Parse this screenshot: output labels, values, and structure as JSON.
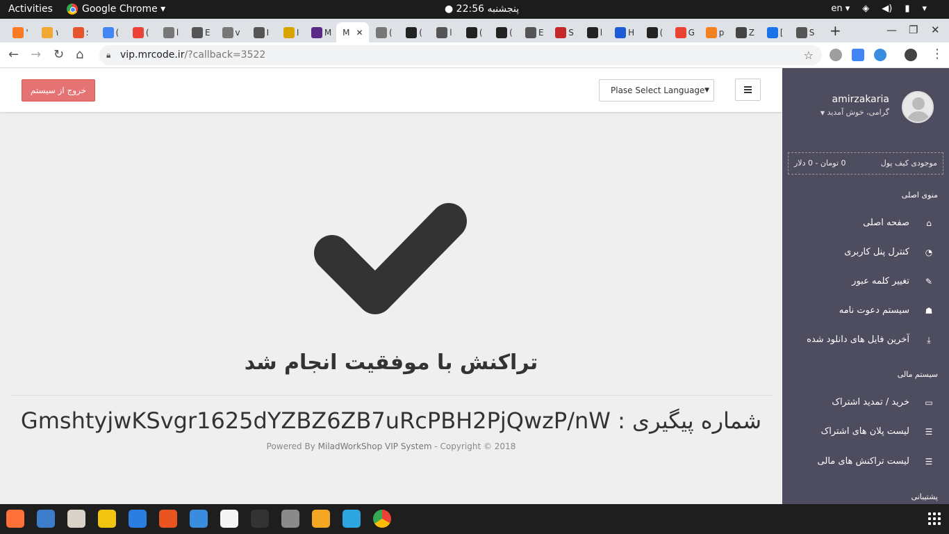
{
  "system_bar": {
    "activities": "Activities",
    "app_name": "Google Chrome ▾",
    "clock": "پنجشنبه 22:56 ●",
    "language": "en ▾",
    "tray_icons": [
      "wifi-icon",
      "volume-icon",
      "battery-icon",
      "power-icon"
    ]
  },
  "browser": {
    "url_host": "vip.mrcode.ir",
    "url_path": "/?callback=3522",
    "active_tab_title": "M",
    "tabs": [
      {
        "icon": "xampp-icon",
        "title": "'",
        "color": "#fb7a24"
      },
      {
        "icon": "pma-icon",
        "title": "۱",
        "color": "#f0a830"
      },
      {
        "icon": "p-icon",
        "title": "؛",
        "color": "#e8522d"
      },
      {
        "icon": "translate-icon",
        "title": "(",
        "color": "#4285f4"
      },
      {
        "icon": "google-icon",
        "title": "(",
        "color": "#ea4335"
      },
      {
        "icon": "globe-icon",
        "title": "l",
        "color": "#777"
      },
      {
        "icon": "globe-icon",
        "title": "E",
        "color": "#555"
      },
      {
        "icon": "globe-icon",
        "title": "v",
        "color": "#777"
      },
      {
        "icon": "globe-icon",
        "title": "I",
        "color": "#555"
      },
      {
        "icon": "badge-icon",
        "title": "ا",
        "color": "#d9a300"
      },
      {
        "icon": "vip-icon",
        "title": "M",
        "color": "#5b2a86"
      },
      {
        "icon": "globe-icon",
        "title": "(",
        "color": "#777"
      },
      {
        "icon": "github-icon",
        "title": "(",
        "color": "#222"
      },
      {
        "icon": "globe-icon",
        "title": "l",
        "color": "#555"
      },
      {
        "icon": "github-icon",
        "title": "(",
        "color": "#222"
      },
      {
        "icon": "github-icon",
        "title": "(",
        "color": "#222"
      },
      {
        "icon": "globe-icon",
        "title": "E",
        "color": "#555"
      },
      {
        "icon": "bug-icon",
        "title": "S",
        "color": "#c62828"
      },
      {
        "icon": "github-icon",
        "title": "l",
        "color": "#222"
      },
      {
        "icon": "w-icon",
        "title": "H",
        "color": "#1e5bd8"
      },
      {
        "icon": "github-icon",
        "title": "(",
        "color": "#222"
      },
      {
        "icon": "google-icon",
        "title": "G",
        "color": "#ea4335"
      },
      {
        "icon": "stack-icon",
        "title": "p",
        "color": "#f48024"
      },
      {
        "icon": "z-icon",
        "title": "Z",
        "color": "#444"
      },
      {
        "icon": "download-icon",
        "title": "[",
        "color": "#1a73e8"
      },
      {
        "icon": "globe-icon",
        "title": "S",
        "color": "#555"
      }
    ]
  },
  "header": {
    "logout_label": "خروج از سیستم",
    "language_select": "Plase Select Language"
  },
  "main": {
    "success_message": "تراکنش با موفقیت انجام شد",
    "tracking_label": "شماره پیگیری :",
    "tracking_code": "GmshtyjwKSvgr1625dYZBZ6ZB7uRcPBH2PjQwzP/nW",
    "powered_prefix": "Powered By",
    "powered_brand": "MiladWorkShop VIP System",
    "powered_suffix": "- Copyright © 2018"
  },
  "sidebar": {
    "username": "amirzakaria",
    "welcome": "گرامی، خوش آمدید",
    "wallet_label": "موجودی کیف پول",
    "wallet_value": "0 تومان - 0 دلار",
    "main_menu_title": "منوی اصلی",
    "main_menu": [
      {
        "label": "صفحه اصلی",
        "icon": "home-icon"
      },
      {
        "label": "کنترل پنل کاربری",
        "icon": "dashboard-icon"
      },
      {
        "label": "تغییر کلمه عبور",
        "icon": "edit-icon"
      },
      {
        "label": "سیستم دعوت نامه",
        "icon": "sitemap-icon"
      },
      {
        "label": "آخرین فایل های دانلود شده",
        "icon": "download-icon"
      }
    ],
    "finance_title": "سیستم مالی",
    "finance_menu": [
      {
        "label": "خرید / تمدید اشتراک",
        "icon": "credit-card-icon"
      },
      {
        "label": "لیست پلان های اشتراک",
        "icon": "list-icon"
      },
      {
        "label": "لیست تراکنش های مالی",
        "icon": "list-icon"
      }
    ],
    "support_title": "پشتیبانی"
  },
  "taskbar": {
    "apps": [
      "firefox-icon",
      "thunderbird-icon",
      "files-icon",
      "rhythmbox-icon",
      "libreoffice-writer-icon",
      "software-center-icon",
      "help-icon",
      "amazon-icon",
      "terminal-icon",
      "settings-icon",
      "sublime-text-icon",
      "telegram-icon",
      "chrome-icon"
    ]
  }
}
